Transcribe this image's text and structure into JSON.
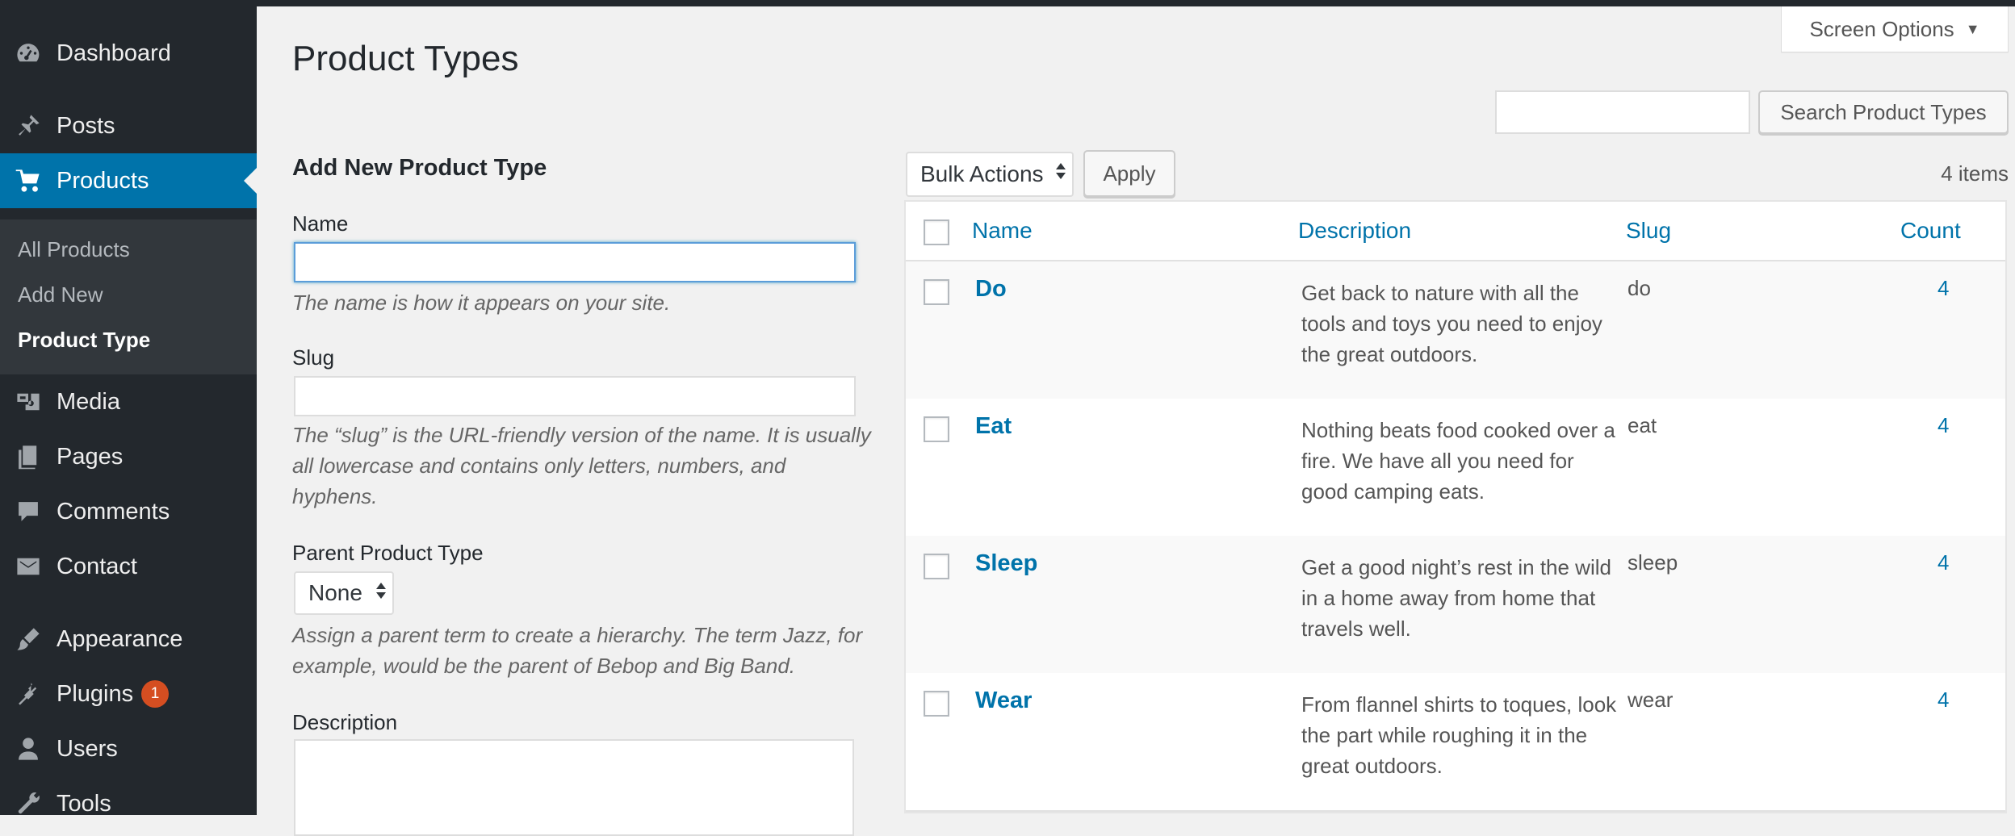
{
  "sidebar": {
    "items": [
      {
        "label": "Dashboard",
        "icon": "dashboard-icon"
      },
      {
        "label": "Posts",
        "icon": "pin-icon"
      },
      {
        "label": "Products",
        "icon": "cart-icon"
      },
      {
        "label": "Media",
        "icon": "media-icon"
      },
      {
        "label": "Pages",
        "icon": "pages-icon"
      },
      {
        "label": "Comments",
        "icon": "comment-icon"
      },
      {
        "label": "Contact",
        "icon": "mail-icon"
      },
      {
        "label": "Appearance",
        "icon": "brush-icon"
      },
      {
        "label": "Plugins",
        "icon": "plugin-icon",
        "badge": "1"
      },
      {
        "label": "Users",
        "icon": "user-icon"
      },
      {
        "label": "Tools",
        "icon": "wrench-icon"
      }
    ],
    "submenu": [
      "All Products",
      "Add New",
      "Product Type"
    ]
  },
  "header": {
    "title": "Product Types",
    "screen_options": "Screen Options",
    "search_button": "Search Product Types"
  },
  "form": {
    "heading": "Add New Product Type",
    "name_label": "Name",
    "name_help": "The name is how it appears on your site.",
    "slug_label": "Slug",
    "slug_help": "The “slug” is the URL-friendly version of the name. It is usually all lowercase and contains only letters, numbers, and hyphens.",
    "parent_label": "Parent Product Type",
    "parent_value": "None",
    "parent_help": "Assign a parent term to create a hierarchy. The term Jazz, for example, would be the parent of Bebop and Big Band.",
    "description_label": "Description"
  },
  "table": {
    "bulk_actions": "Bulk Actions",
    "apply": "Apply",
    "items_count": "4 items",
    "columns": {
      "name": "Name",
      "description": "Description",
      "slug": "Slug",
      "count": "Count"
    },
    "rows": [
      {
        "name": "Do",
        "description": "Get back to nature with all the tools and toys you need to enjoy the great outdoors.",
        "slug": "do",
        "count": "4"
      },
      {
        "name": "Eat",
        "description": "Nothing beats food cooked over a fire. We have all you need for good camping eats.",
        "slug": "eat",
        "count": "4"
      },
      {
        "name": "Sleep",
        "description": "Get a good night’s rest in the wild in a home away from home that travels well.",
        "slug": "sleep",
        "count": "4"
      },
      {
        "name": "Wear",
        "description": "From flannel shirts to toques, look the part while roughing it in the great outdoors.",
        "slug": "wear",
        "count": "4"
      }
    ]
  },
  "colors": {
    "sidebar": "#23282d",
    "accent": "#0073aa",
    "badge": "#d54e21"
  }
}
